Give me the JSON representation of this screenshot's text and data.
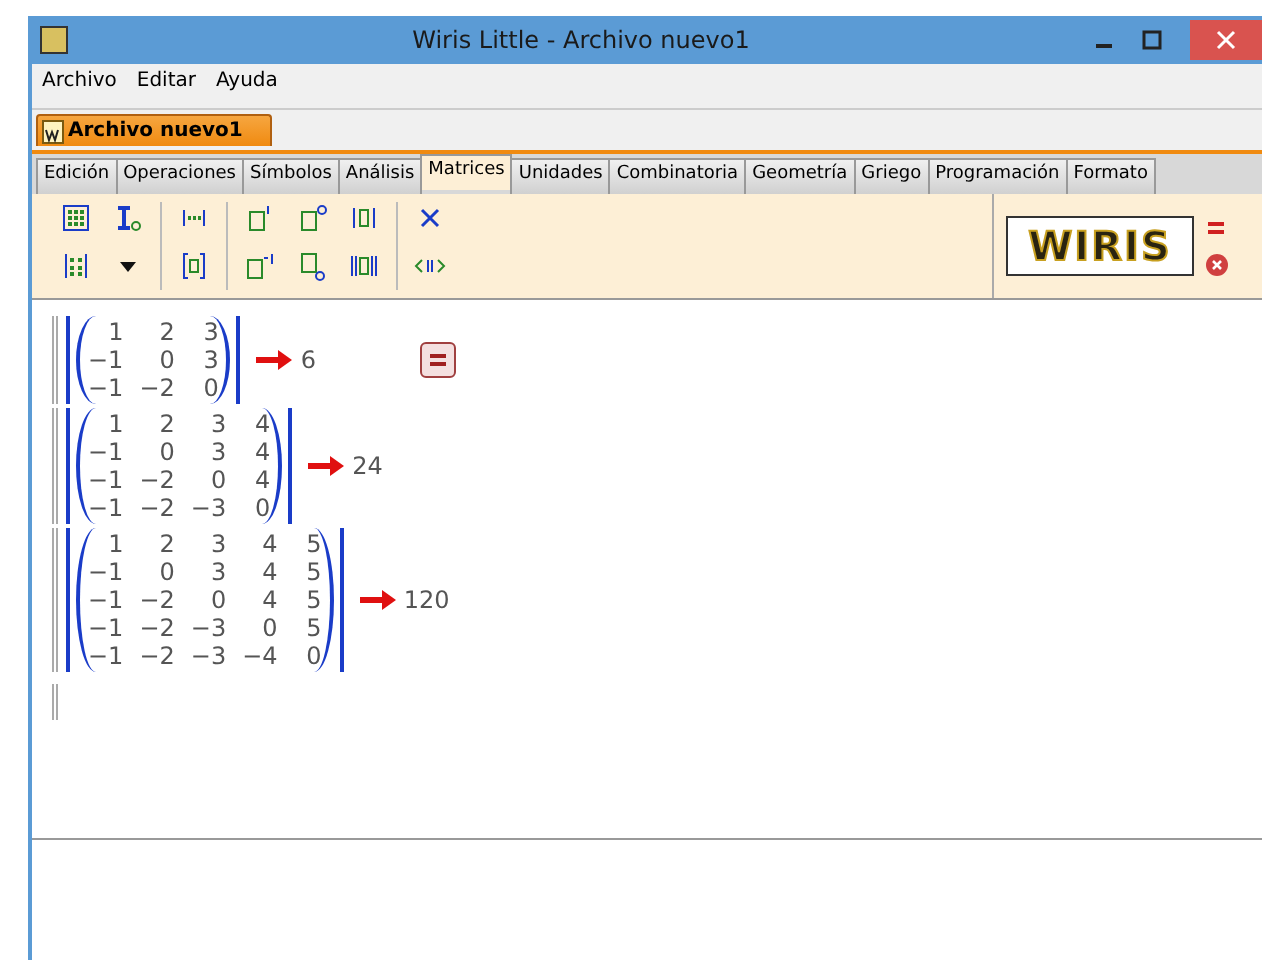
{
  "window": {
    "title": "Wiris Little - Archivo nuevo1"
  },
  "menu": [
    "Archivo",
    "Editar",
    "Ayuda"
  ],
  "document_tab": {
    "label": "Archivo nuevo1"
  },
  "tabs": [
    {
      "label": "Edición",
      "selected": false
    },
    {
      "label": "Operaciones",
      "selected": false
    },
    {
      "label": "Símbolos",
      "selected": false
    },
    {
      "label": "Análisis",
      "selected": false
    },
    {
      "label": "Matrices",
      "selected": true
    },
    {
      "label": "Unidades",
      "selected": false
    },
    {
      "label": "Combinatoria",
      "selected": false
    },
    {
      "label": "Geometría",
      "selected": false
    },
    {
      "label": "Griego",
      "selected": false
    },
    {
      "label": "Programación",
      "selected": false
    },
    {
      "label": "Formato",
      "selected": false
    }
  ],
  "logo": {
    "text": "WIRIS"
  },
  "blocks": [
    {
      "matrix": [
        [
          "1",
          "2",
          "3"
        ],
        [
          "−1",
          "0",
          "3"
        ],
        [
          "−1",
          "−2",
          "0"
        ]
      ],
      "result": "6",
      "calc_button": true
    },
    {
      "matrix": [
        [
          "1",
          "2",
          "3",
          "4"
        ],
        [
          "−1",
          "0",
          "3",
          "4"
        ],
        [
          "−1",
          "−2",
          "0",
          "4"
        ],
        [
          "−1",
          "−2",
          "−3",
          "0"
        ]
      ],
      "result": "24",
      "calc_button": false
    },
    {
      "matrix": [
        [
          "1",
          "2",
          "3",
          "4",
          "5"
        ],
        [
          "−1",
          "0",
          "3",
          "4",
          "5"
        ],
        [
          "−1",
          "−2",
          "0",
          "4",
          "5"
        ],
        [
          "−1",
          "−2",
          "−3",
          "0",
          "5"
        ],
        [
          "−1",
          "−2",
          "−3",
          "−4",
          "0"
        ]
      ],
      "result": "120",
      "calc_button": false
    }
  ]
}
